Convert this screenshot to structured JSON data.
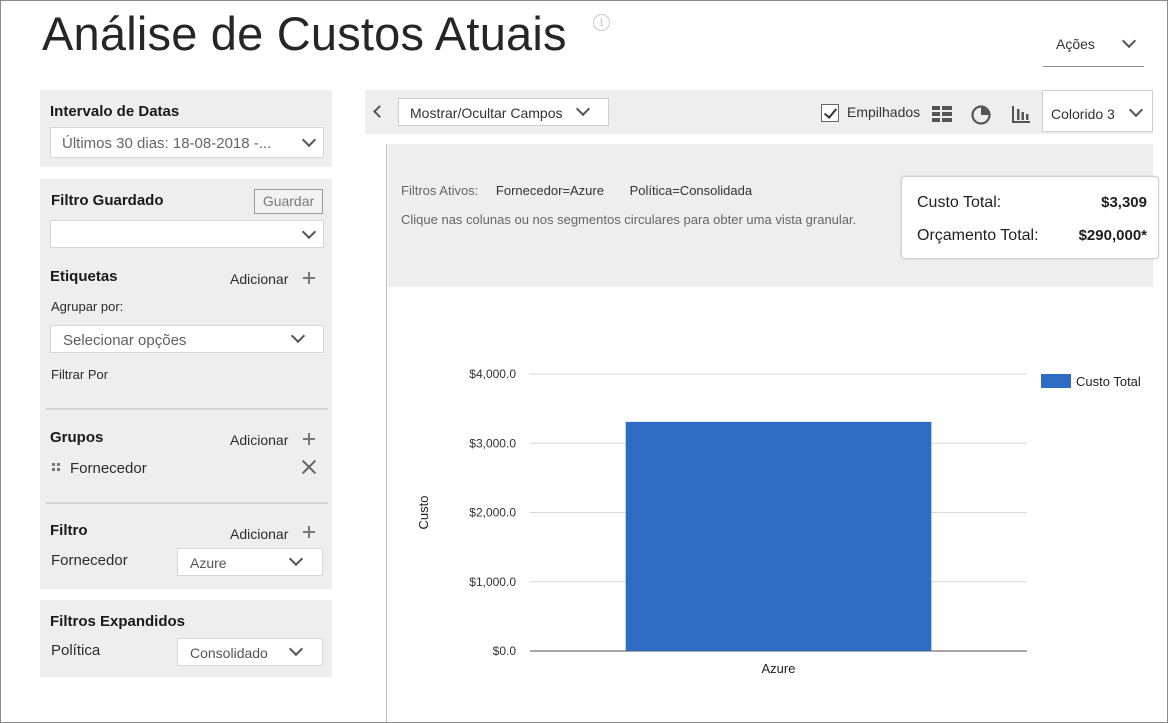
{
  "header": {
    "title": "Análise de Custos Atuais",
    "info_icon": "info-icon",
    "actions_label": "Ações"
  },
  "sidebar": {
    "date_range": {
      "title": "Intervalo de Datas",
      "value": "Últimos 30 dias: 18-08-2018 -..."
    },
    "saved_filter": {
      "title": "Filtro Guardado",
      "save_label": "Guardar",
      "value": ""
    },
    "tags": {
      "title": "Etiquetas",
      "add_label": "Adicionar",
      "group_by_label": "Agrupar por:",
      "group_by_placeholder": "Selecionar opções",
      "filter_by_label": "Filtrar Por"
    },
    "groups": {
      "title": "Grupos",
      "add_label": "Adicionar",
      "items": [
        {
          "label": "Fornecedor"
        }
      ]
    },
    "filter": {
      "title": "Filtro",
      "add_label": "Adicionar",
      "field_label": "Fornecedor",
      "field_value": "Azure"
    },
    "expanded_filters": {
      "title": "Filtros Expandidos",
      "field_label": "Política",
      "field_value": "Consolidado"
    }
  },
  "toolbar": {
    "fields_label": "Mostrar/Ocultar Campos",
    "stacked_label": "Empilhados",
    "stacked_checked": true,
    "color_scheme": "Colorido 3",
    "icons": [
      "table-view-icon",
      "pie-chart-icon",
      "bar-chart-icon"
    ]
  },
  "summary": {
    "active_filters_label": "Filtros Ativos:",
    "active_filters": [
      "Fornecedor=Azure",
      "Política=Consolidada"
    ],
    "hint": "Clique nas colunas ou nos segmentos circulares para obter uma vista granular.",
    "total_cost_label": "Custo Total:",
    "total_cost_value": "$3,309",
    "total_budget_label": "Orçamento Total:",
    "total_budget_value": "$290,000*"
  },
  "chart_data": {
    "type": "bar",
    "categories": [
      "Azure"
    ],
    "series": [
      {
        "name": "Custo Total",
        "values": [
          3309
        ],
        "color": "#2f6bc3"
      }
    ],
    "title": "",
    "xlabel": "",
    "ylabel": "Custo",
    "ylim": [
      0,
      4000
    ],
    "yticks": [
      0,
      1000,
      2000,
      3000,
      4000
    ],
    "ytick_labels": [
      "$0.0",
      "$1,000.0",
      "$2,000.0",
      "$3,000.0",
      "$4,000.0"
    ],
    "grid": true,
    "legend_position": "top-right"
  }
}
